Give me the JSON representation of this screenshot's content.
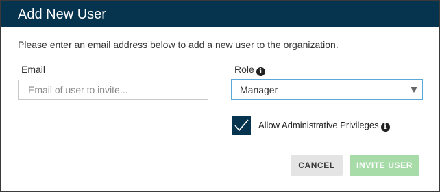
{
  "dialog": {
    "title": "Add New User",
    "intro": "Please enter an email address below to add a new user to the organization."
  },
  "email": {
    "label": "Email",
    "value": "",
    "placeholder": "Email of user to invite..."
  },
  "role": {
    "label": "Role",
    "info_icon": "i",
    "selected": "Manager"
  },
  "admin": {
    "label": "Allow Administrative Privileges",
    "checked": true,
    "info_icon": "i"
  },
  "buttons": {
    "cancel": "CANCEL",
    "invite": "INVITE USER"
  },
  "colors": {
    "header_bg": "#06344f",
    "checkbox_bg": "#06344f",
    "select_border": "#5aa7d8",
    "invite_bg": "#a7dba8",
    "cancel_bg": "#e4e4e4"
  },
  "icons": {
    "role_info": "info-icon",
    "admin_info": "info-icon",
    "check": "checkmark-icon",
    "dropdown": "caret-down-icon"
  }
}
